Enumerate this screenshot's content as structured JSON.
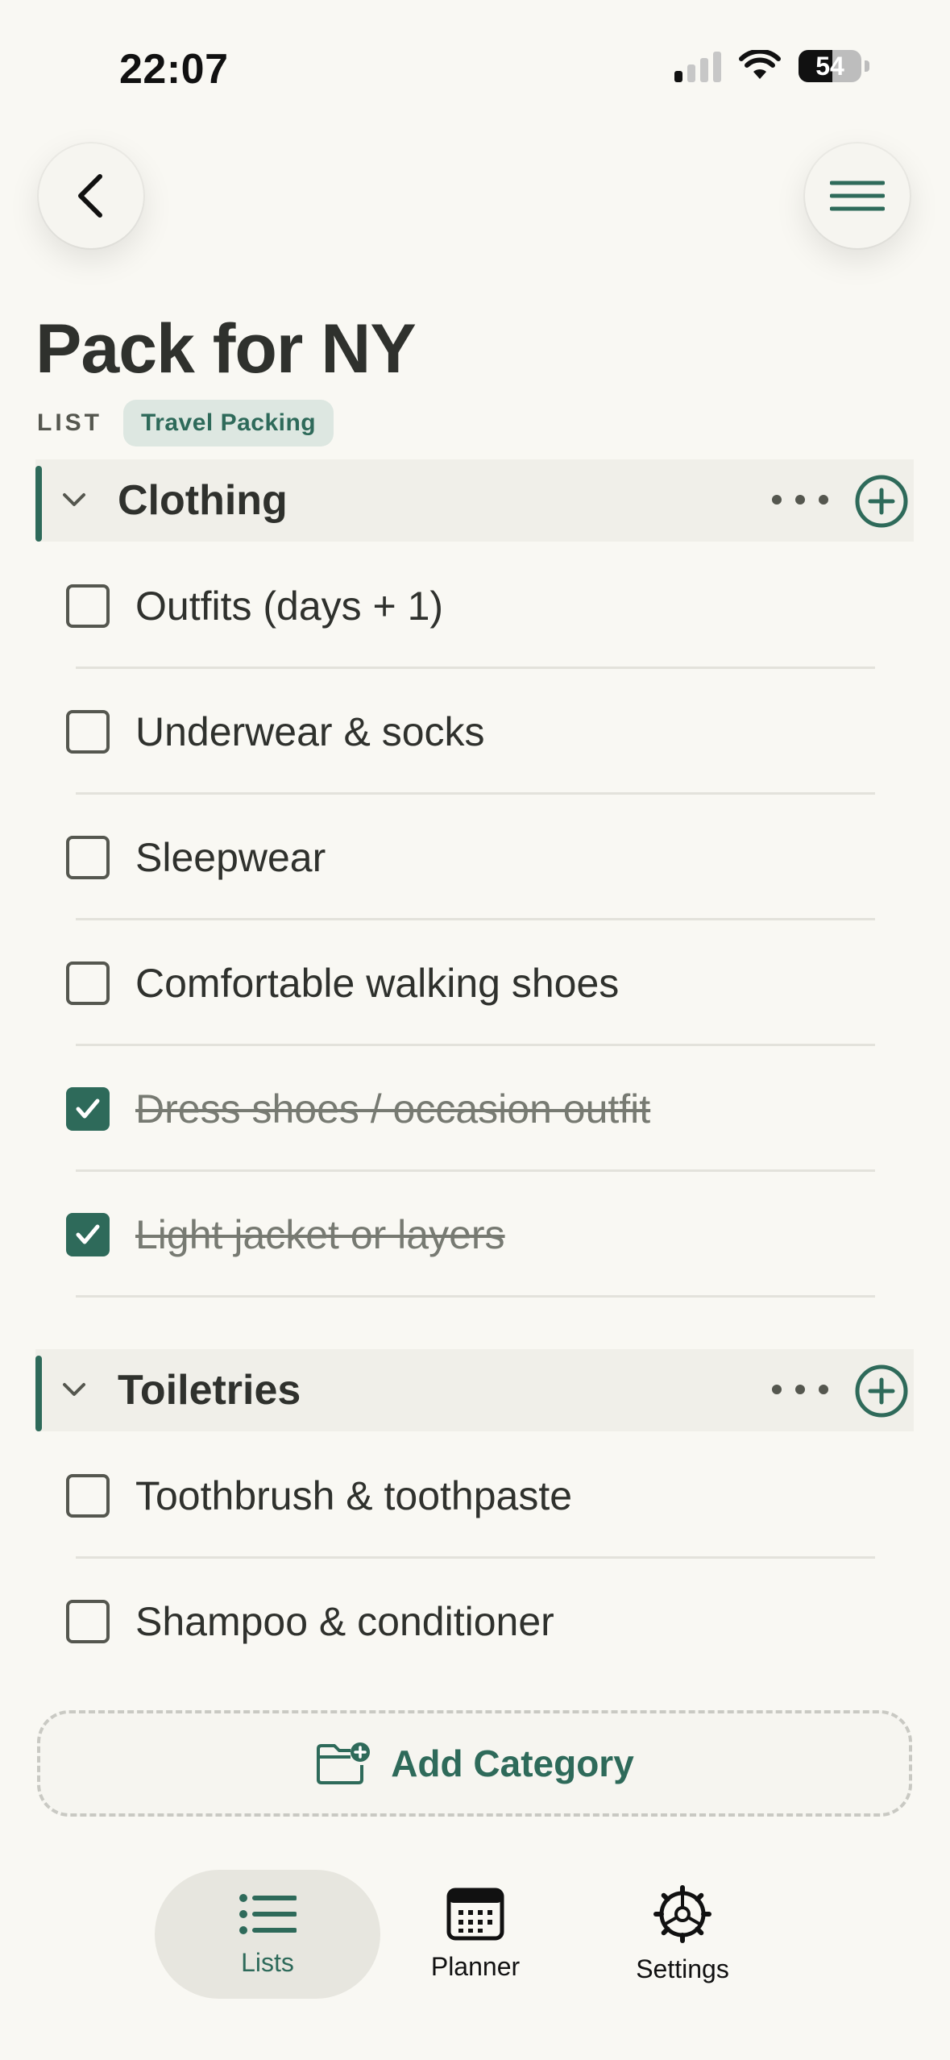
{
  "status_bar": {
    "time": "22:07",
    "battery": "54"
  },
  "header": {
    "title": "Pack for NY",
    "list_label": "LIST",
    "tag": "Travel Packing"
  },
  "colors": {
    "accent": "#2e6a5a",
    "background": "#f9f8f3"
  },
  "categories": [
    {
      "title": "Clothing",
      "items": [
        {
          "label": "Outfits (days + 1)",
          "checked": false
        },
        {
          "label": "Underwear & socks",
          "checked": false
        },
        {
          "label": "Sleepwear",
          "checked": false
        },
        {
          "label": "Comfortable walking shoes",
          "checked": false
        },
        {
          "label": "Dress shoes / occasion outfit",
          "checked": true
        },
        {
          "label": "Light jacket or layers",
          "checked": true
        }
      ]
    },
    {
      "title": "Toiletries",
      "items": [
        {
          "label": "Toothbrush & toothpaste",
          "checked": false
        },
        {
          "label": "Shampoo & conditioner",
          "checked": false
        }
      ]
    }
  ],
  "add_category_label": "Add Category",
  "tabs": [
    {
      "label": "Lists",
      "icon": "list-icon",
      "active": true
    },
    {
      "label": "Planner",
      "icon": "calendar-icon",
      "active": false
    },
    {
      "label": "Settings",
      "icon": "gear-icon",
      "active": false
    }
  ]
}
